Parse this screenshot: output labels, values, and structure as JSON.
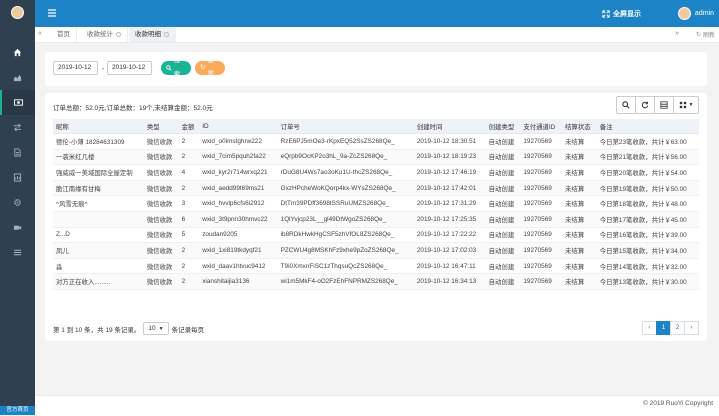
{
  "topbar": {
    "fullscreen_label": "全屏显示",
    "user": "admin"
  },
  "sidebar": {
    "scroll_tip": "官方首页"
  },
  "tabs": [
    {
      "label": "首页"
    },
    {
      "label": "收款统计"
    },
    {
      "label": "收款明细"
    }
  ],
  "toolbar_right": {
    "refresh_label": "刷新"
  },
  "search": {
    "start_date": "2019-10-12",
    "separator": "-",
    "end_date": "2019-10-12",
    "search_label": "搜索",
    "reset_label": "重置"
  },
  "summary": "订单总额：52.0元,订单总数：19个,未结算金额：52.0元",
  "table": {
    "columns": [
      "昵称",
      "类型",
      "金额",
      "ID",
      "订单号",
      "创建时间",
      "创建类型",
      "支付通道ID",
      "结算状态",
      "备注"
    ],
    "rows": [
      {
        "nick": "德伦-小薄 18284631309",
        "type": "微信收款",
        "amount": "2",
        "id": "wxid_o0imstghrw222",
        "order": "RzE6PJ5mOe3-rKpxEQ52SsZS268Qe_",
        "time": "2019-10-12 18:30:51",
        "ctype": "自动创建",
        "channel": "19270569",
        "status": "未结算",
        "note": "今日第23笔收款，共计￥63.00"
      },
      {
        "nick": "一袭米红几楼",
        "type": "微信收款",
        "amount": "2",
        "id": "wxid_7cim5pquh2fa22",
        "order": "eQrpb9OcKP2o3hL_9a-ZcZS268Qe_",
        "time": "2019-10-12 18:19:23",
        "ctype": "自动创建",
        "channel": "19270569",
        "status": "未结算",
        "note": "今日第21笔收款，共计￥56.00"
      },
      {
        "nick": "强威威一美域国际全屋定制",
        "type": "微信收款",
        "amount": "4",
        "id": "wxid_kyr2r714wrxq221",
        "order": "rDuG8U4Ws7ao3oKu1U-thcZS268Qe_",
        "time": "2019-10-12 17:46:19",
        "ctype": "自动创建",
        "channel": "19270569",
        "status": "未结算",
        "note": "今日第20笔收款，共计￥54.00"
      },
      {
        "nick": "脆江南缘有甘梅",
        "type": "微信收款",
        "amount": "2",
        "id": "wxid_aedd99t69ms21",
        "order": "GxzHPcheWoKQorp4kx-WYsZS268Qe_",
        "time": "2019-10-12 17:42:01",
        "ctype": "自动创建",
        "channel": "19270569",
        "status": "未结算",
        "note": "今日第19笔收款，共计￥50.00"
      },
      {
        "nick": "^风雪无痕^",
        "type": "微信收款",
        "amount": "3",
        "id": "wxid_hvvlp6cfs6i2912",
        "order": "DtTm39PDff3698tSSRuUMZS268Qe_",
        "time": "2019-10-12 17:31:29",
        "ctype": "自动创建",
        "channel": "19270569",
        "status": "未结算",
        "note": "今日第18笔收款，共计￥48.00"
      },
      {
        "nick": "",
        "type": "微信收款",
        "amount": "6",
        "id": "wxid_3t9pnn30hmvc22",
        "order": "1QlYvjcp23L__gl49DtWgoZS268Qe_",
        "time": "2019-10-12 17:25:35",
        "ctype": "自动创建",
        "channel": "19270569",
        "status": "未结算",
        "note": "今日第17笔收款，共计￥45.00"
      },
      {
        "nick": "Z...D",
        "type": "微信收款",
        "amount": "5",
        "id": "zoudan9205",
        "order": "ib8RDkHwkHgCSF5zhVfOL8ZS268Qe_",
        "time": "2019-10-12 17:22:22",
        "ctype": "自动创建",
        "channel": "19270569",
        "status": "未结算",
        "note": "今日第16笔收款，共计￥39.00"
      },
      {
        "nick": "凤儿",
        "type": "微信收款",
        "amount": "2",
        "id": "wxid_1xi819tkdyqf21",
        "order": "PZCWU4g8MSKhFz9xhe9pZoZS268Qe_",
        "time": "2019-10-12 17:02:03",
        "ctype": "自动创建",
        "channel": "19270569",
        "status": "未结算",
        "note": "今日第15笔收款，共计￥34.00"
      },
      {
        "nick": "淼",
        "type": "微信收款",
        "amount": "2",
        "id": "wxid_daav1htvuc9412",
        "order": "T9i0XmxnFiSC1zThqsuQcZS268Qe_",
        "time": "2019-10-12 16:47:11",
        "ctype": "自动创建",
        "channel": "19270569",
        "status": "未结算",
        "note": "今日第14笔收款，共计￥32.00"
      },
      {
        "nick": "对方正在收入.........",
        "type": "微信收款",
        "amount": "2",
        "id": "xianshitaijia3136",
        "order": "wi1m5MkF4-oO2FzEhFNPRMZS268Qe_",
        "time": "2019-10-12 16:34:13",
        "ctype": "自动创建",
        "channel": "19270569",
        "status": "未结算",
        "note": "今日第13笔收款，共计￥30.00"
      }
    ]
  },
  "pager": {
    "info": "第 1 到 10 条，共 19 条记录。",
    "page_size": "10",
    "per_page_suffix": "条记录每页",
    "prev": "‹",
    "pages": [
      "1",
      "2"
    ],
    "next": "›"
  },
  "footer": "© 2019 RuoYi Copyright",
  "colors": {
    "primary": "#1c84c6",
    "sidebar": "#2f4050",
    "success": "#1ab394",
    "warning": "#f8ac59"
  }
}
